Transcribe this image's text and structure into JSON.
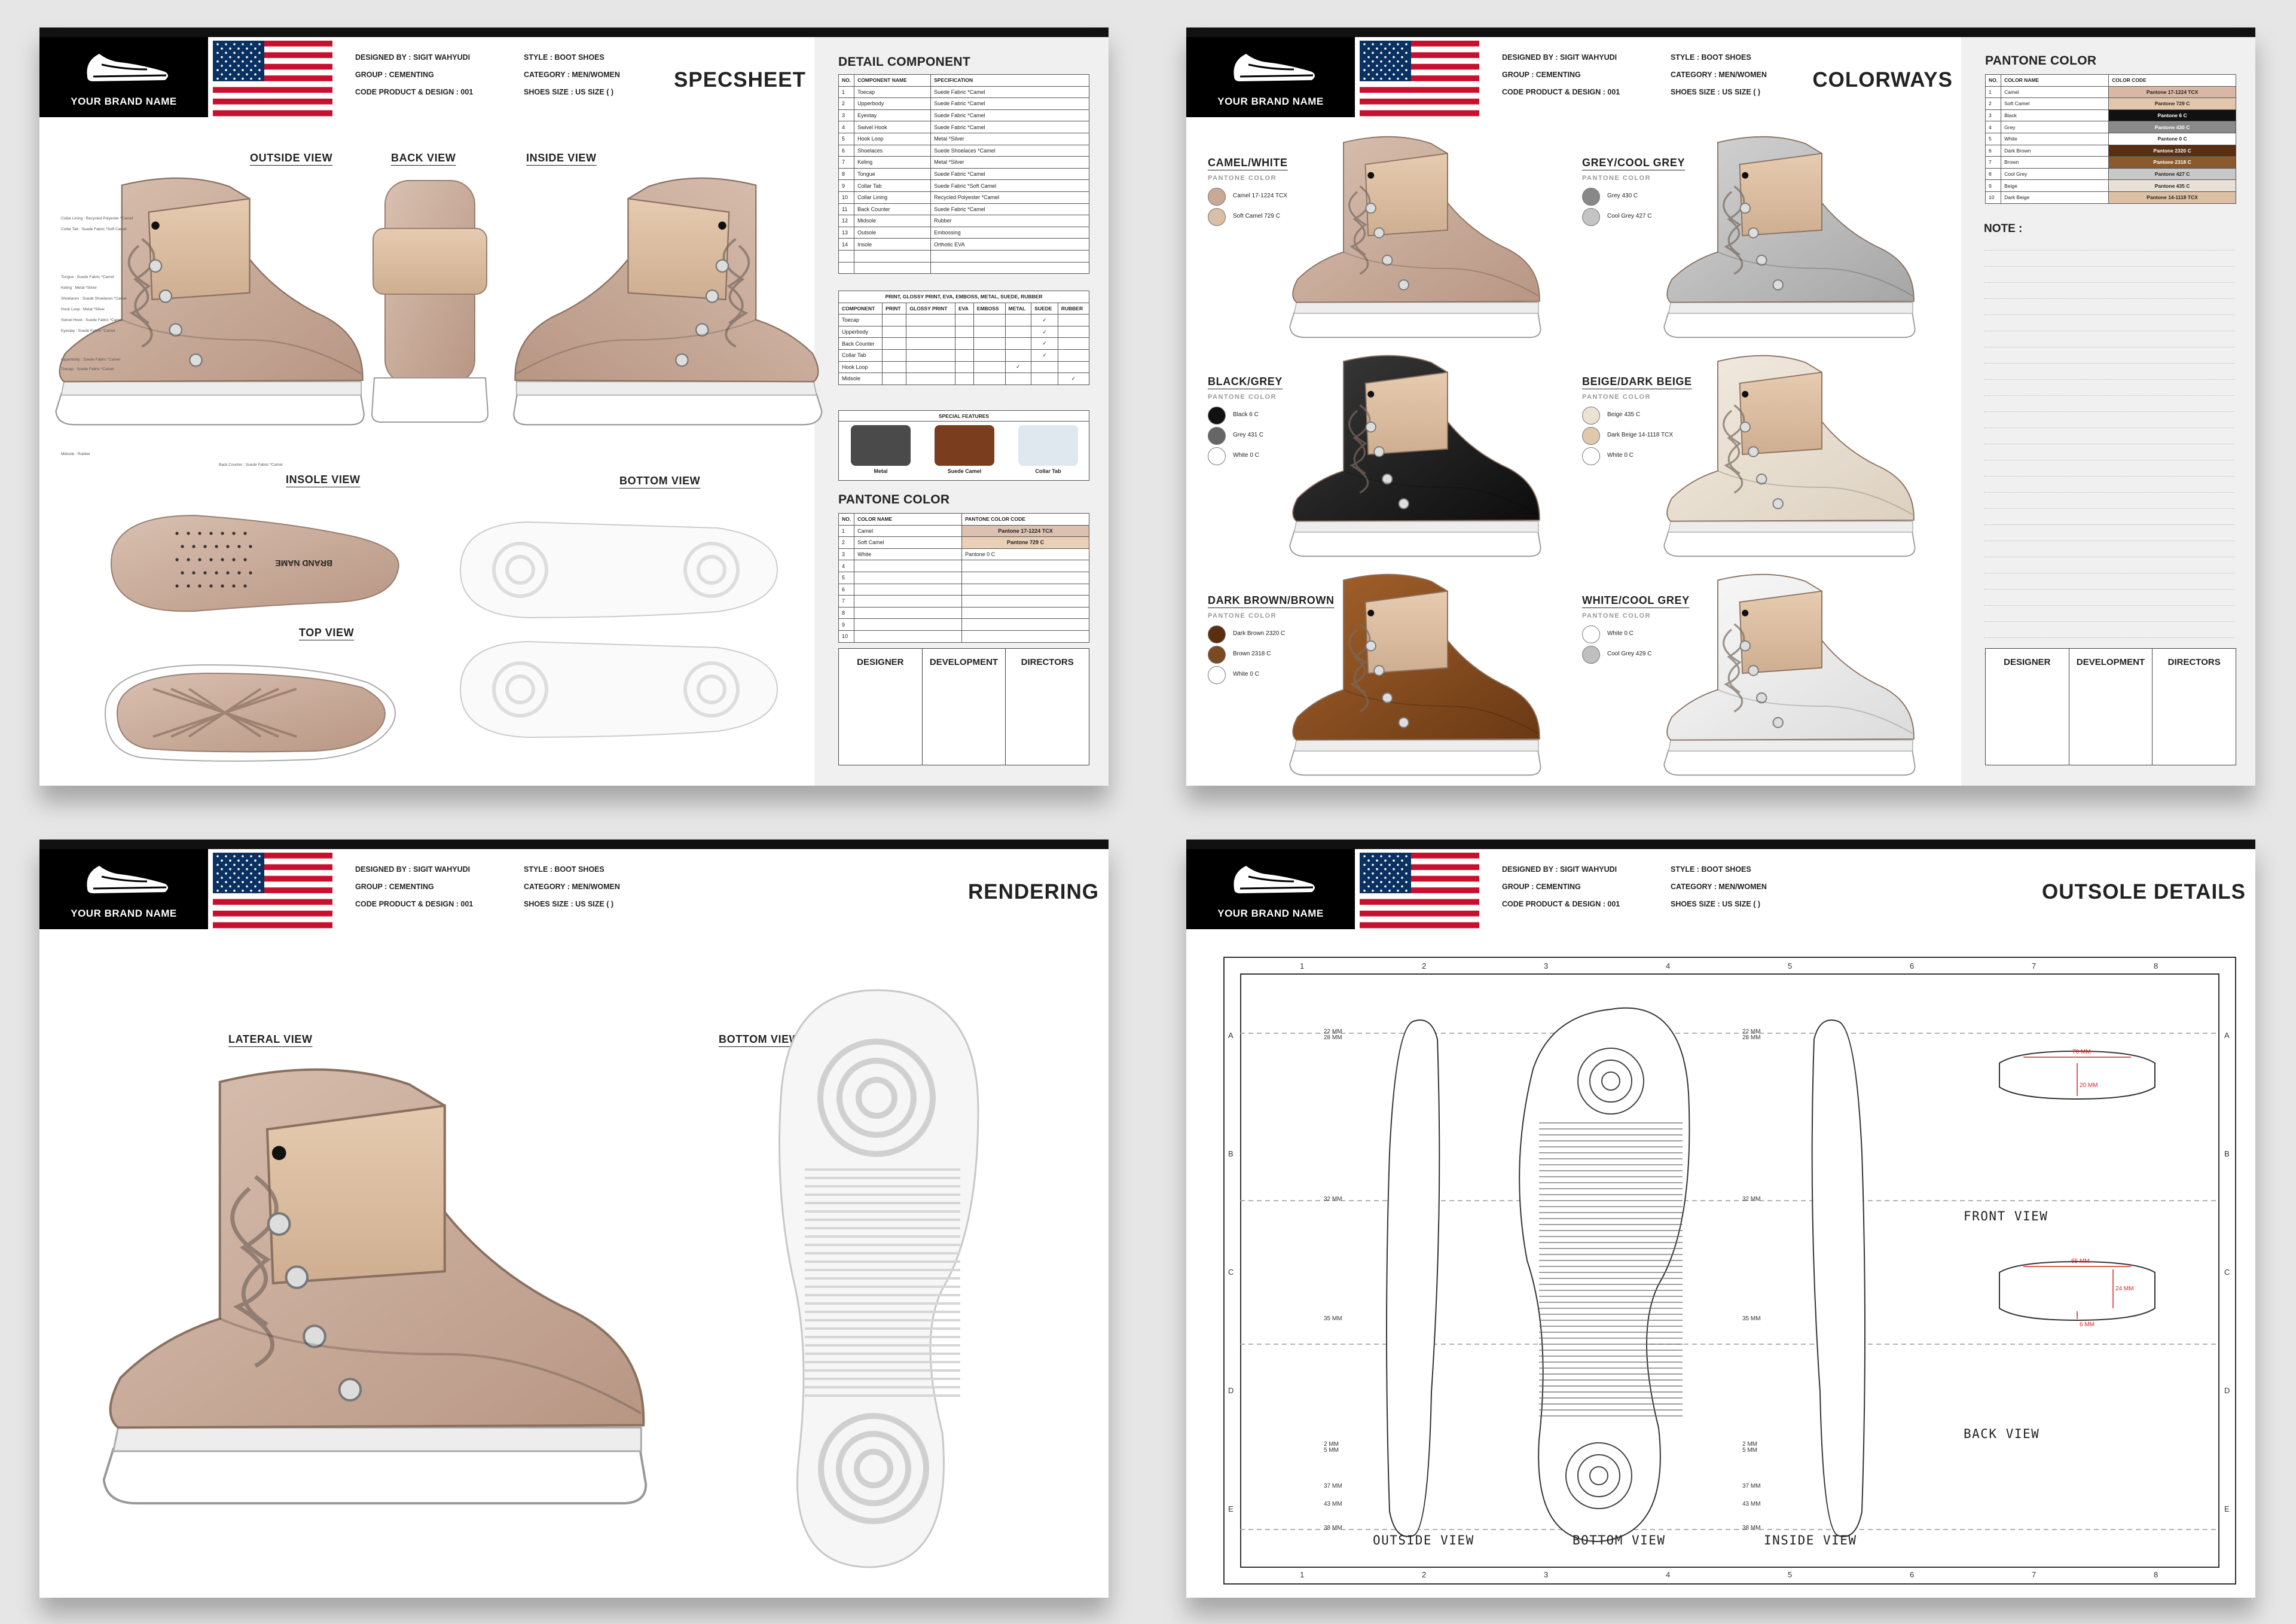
{
  "header": {
    "brand_name": "YOUR BRAND NAME",
    "designed_by": "DESIGNED BY : SIGIT WAHYUDI",
    "group": "GROUP : CEMENTING",
    "code": "CODE PRODUCT & DESIGN : 001",
    "style": "STYLE : BOOT SHOES",
    "category": "CATEGORY : MEN/WOMEN",
    "size": "SHOES SIZE : US SIZE (   )"
  },
  "specsheet": {
    "title": "SPECSHEET",
    "views": {
      "outside": "OUTSIDE VIEW",
      "back": "BACK VIEW",
      "inside": "INSIDE VIEW",
      "insole": "INSOLE VIEW",
      "bottom": "BOTTOM VIEW",
      "top": "TOP VIEW"
    },
    "detail_title": "DETAIL COMPONENT",
    "detail_headers": [
      "NO.",
      "COMPONENT NAME",
      "SPECIFICATION"
    ],
    "detail_rows": [
      [
        "1",
        "Toecap",
        "Suede Fabric *Camel"
      ],
      [
        "2",
        "Upperbody",
        "Suede Fabric *Camel"
      ],
      [
        "3",
        "Eyestay",
        "Suede Fabric *Camel"
      ],
      [
        "4",
        "Swivel Hook",
        "Suede Fabric *Camel"
      ],
      [
        "5",
        "Hook Loop",
        "Metal *Silver"
      ],
      [
        "6",
        "Shoelaces",
        "Suede Shoelaces *Camel"
      ],
      [
        "7",
        "Keling",
        "Metal *Silver"
      ],
      [
        "8",
        "Tongue",
        "Suede Fabric *Camel"
      ],
      [
        "9",
        "Collar Tab",
        "Suede Fabric *Soft Camel"
      ],
      [
        "10",
        "Collar Lining",
        "Recycled Polyester *Camel"
      ],
      [
        "11",
        "Back Counter",
        "Suede Fabric *Camel"
      ],
      [
        "12",
        "Midsole",
        "Rubber"
      ],
      [
        "13",
        "Outsole",
        "Embossing"
      ],
      [
        "14",
        "Insole",
        "Orthotic EVA"
      ],
      [
        "",
        "",
        " "
      ],
      [
        "",
        "",
        ""
      ]
    ],
    "print_title": "PRINT, GLOSSY PRINT, EVA, EMBOSS, METAL, SUEDE, RUBBER",
    "print_headers": [
      "COMPONENT",
      "PRINT",
      "GLOSSY PRINT",
      "EVA",
      "EMBOSS",
      "METAL",
      "SUEDE",
      "RUBBER"
    ],
    "print_rows": [
      [
        "Toecap",
        "",
        "",
        "",
        "",
        "",
        "✓",
        ""
      ],
      [
        "Upperbody",
        "",
        "",
        "",
        "",
        "",
        "✓",
        ""
      ],
      [
        "Back Counter",
        "",
        "",
        "",
        "",
        "",
        "✓",
        ""
      ],
      [
        "Collar Tab",
        "",
        "",
        "",
        "",
        "",
        "✓",
        ""
      ],
      [
        "Hook Loop",
        "",
        "",
        "",
        "",
        "✓",
        "",
        ""
      ],
      [
        "Midsole",
        "",
        "",
        "",
        "",
        "",
        "",
        "✓"
      ]
    ],
    "special_features_title": "SPECIAL FEATURES",
    "special_features": [
      "Metal",
      "Suede Camel",
      "Collar Tab"
    ],
    "pantone_title": "PANTONE COLOR",
    "pantone_headers": [
      "NO.",
      "COLOR NAME",
      "PANTONE COLOR CODE"
    ],
    "pantone_rows": [
      [
        "1",
        "Camel",
        "Pantone 17-1224 TCX"
      ],
      [
        "2",
        "Soft Camel",
        "Pantone 729 C"
      ],
      [
        "3",
        "White",
        "Pantone 0 C"
      ],
      [
        "4",
        "",
        ""
      ],
      [
        "5",
        "",
        ""
      ],
      [
        "6",
        "",
        ""
      ],
      [
        "7",
        "",
        ""
      ],
      [
        "8",
        "",
        ""
      ],
      [
        "9",
        "",
        ""
      ],
      [
        "10",
        "",
        ""
      ]
    ],
    "callouts": [
      "Collar Lining : Recycled Polyester *Camel",
      "Collar Tab : Suede Fabric *Soft Camel",
      "Tongue : Suede Fabric *Camel",
      "Keling : Metal *Silver",
      "Shoelaces : Suede Shoelaces *Camel",
      "Hook Loop : Metal *Silver",
      "Swivel Hook : Suede Fabric *Camel",
      "Eyestay : Suede Fabric *Camel",
      "Upperbody : Suede Fabric *Camel",
      "Toecap : Suede Fabric *Camel",
      "Midsole : Rubber",
      "Back Counter : Suede Fabric *Camel"
    ],
    "insole_brand": "BRAND NAME"
  },
  "signature": [
    "DESIGNER",
    "DEVELOPMENT",
    "DIRECTORS"
  ],
  "colorways": {
    "title": "COLORWAYS",
    "sub": "PANTONE COLOR",
    "items": [
      {
        "name": "CAMEL/WHITE",
        "colors": [
          {
            "label": "Camel 17-1224 TCX",
            "hex": "#c9a896"
          },
          {
            "label": "Soft Camel 729 C",
            "hex": "#d8bfa6"
          }
        ]
      },
      {
        "name": "GREY/COOL GREY",
        "colors": [
          {
            "label": "Grey 430 C",
            "hex": "#888888"
          },
          {
            "label": "Cool Grey 427 C",
            "hex": "#c4c4c4"
          }
        ]
      },
      {
        "name": "BLACK/GREY",
        "colors": [
          {
            "label": "Black 6 C",
            "hex": "#111111"
          },
          {
            "label": "Grey 431 C",
            "hex": "#666666"
          },
          {
            "label": "White 0 C",
            "hex": "#ffffff"
          }
        ]
      },
      {
        "name": "BEIGE/DARK BEIGE",
        "colors": [
          {
            "label": "Beige 435 C",
            "hex": "#ece2d4"
          },
          {
            "label": "Dark Beige 14-1118 TCX",
            "hex": "#e0c8ab"
          },
          {
            "label": "White 0 C",
            "hex": "#ffffff"
          }
        ]
      },
      {
        "name": "DARK BROWN/BROWN",
        "colors": [
          {
            "label": "Dark Brown 2320 C",
            "hex": "#5a2e10"
          },
          {
            "label": "Brown 2318 C",
            "hex": "#7a4a20"
          },
          {
            "label": "White 0 C",
            "hex": "#ffffff"
          }
        ]
      },
      {
        "name": "WHITE/COOL GREY",
        "colors": [
          {
            "label": "White 0 C",
            "hex": "#ffffff"
          },
          {
            "label": "Cool Grey 429 C",
            "hex": "#bfbfbf"
          }
        ]
      }
    ],
    "pantone_title": "PANTONE COLOR",
    "pantone_headers": [
      "NO.",
      "COLOR NAME",
      "COLOR CODE"
    ],
    "pantone_rows": [
      [
        "1",
        "Camel",
        "Pantone 17-1224 TCX",
        "#d8b8a4"
      ],
      [
        "2",
        "Soft Camel",
        "Pantone 729 C",
        "#e3c7ad"
      ],
      [
        "3",
        "Black",
        "Pantone 6 C",
        "#111111"
      ],
      [
        "4",
        "Grey",
        "Pantone 430 C",
        "#8a8a8a"
      ],
      [
        "5",
        "White",
        "Pantone 0 C",
        "#ffffff"
      ],
      [
        "6",
        "Dark Brown",
        "Pantone 2320 C",
        "#5a2e10"
      ],
      [
        "7",
        "Brown",
        "Pantone 2318 C",
        "#8a5a2e"
      ],
      [
        "8",
        "Cool Grey",
        "Pantone 427 C",
        "#c8c8c8"
      ],
      [
        "9",
        "Beige",
        "Pantone 435 C",
        "#e8e0d6"
      ],
      [
        "10",
        "Dark Beige",
        "Pantone 14-1118 TCX",
        "#dcc0a4"
      ]
    ],
    "note": "NOTE :"
  },
  "rendering": {
    "title": "RENDERING",
    "lateral": "LATERAL VIEW",
    "bottom": "BOTTOM VIEW"
  },
  "outsole": {
    "title": "OUTSOLE DETAILS",
    "cols": [
      "1",
      "2",
      "3",
      "4",
      "5",
      "6",
      "7",
      "8"
    ],
    "rows": [
      "A",
      "B",
      "C",
      "D",
      "E"
    ],
    "captions": [
      "OUTSIDE VIEW",
      "BOTTOM VIEW",
      "INSIDE VIEW",
      "FRONT VIEW",
      "BACK VIEW"
    ],
    "dims": [
      "22 MM",
      "28 MM",
      "32 MM",
      "35 MM",
      "2 MM",
      "5 MM",
      "37 MM",
      "43 MM",
      "38 MM"
    ],
    "front_dims": [
      "70 MM",
      "20 MM"
    ],
    "back_dims": [
      "65 MM",
      "24 MM",
      "6 MM"
    ]
  }
}
